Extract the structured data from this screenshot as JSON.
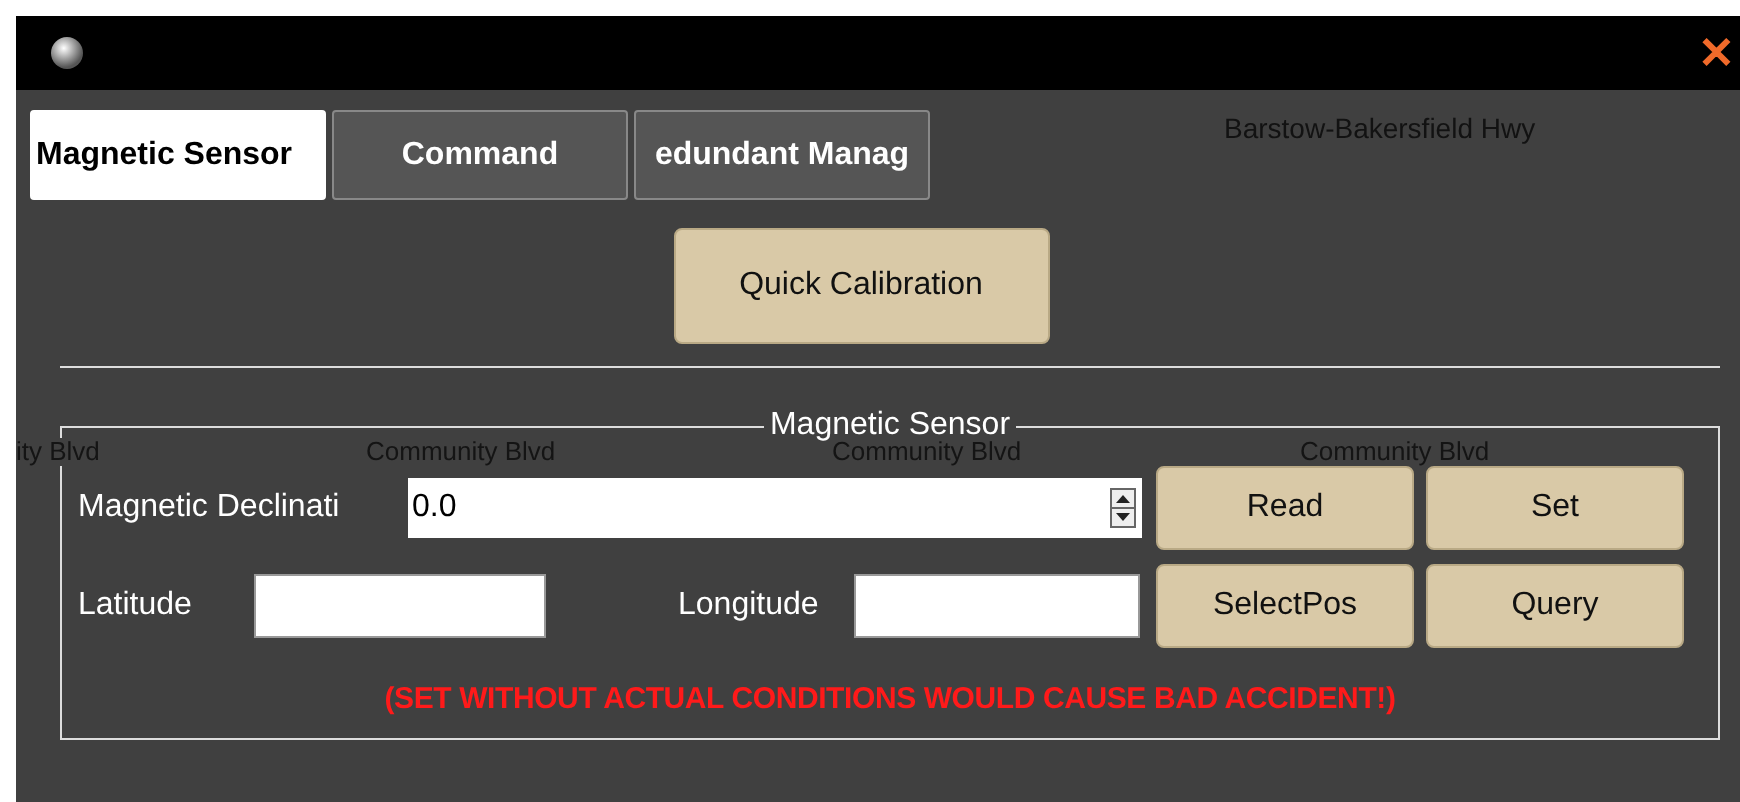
{
  "window": {
    "close": "✕"
  },
  "map_labels": [
    {
      "text": "Barstow-Bakersfield Hwy"
    },
    {
      "text": "ity Blvd"
    },
    {
      "text": "Community Blvd"
    },
    {
      "text": "Community Blvd"
    },
    {
      "text": "Community Blvd"
    }
  ],
  "tabs": [
    {
      "label": "Magnetic Sensor",
      "selected": true
    },
    {
      "label": "Command",
      "selected": false
    },
    {
      "label": "edundant Manag",
      "selected": false
    }
  ],
  "quick_calibration": {
    "label": "Quick Calibration"
  },
  "group": {
    "title": "Magnetic Sensor",
    "declination": {
      "label": "Magnetic Declinati",
      "value": "0.0"
    },
    "latitude": {
      "label": "Latitude"
    },
    "longitude": {
      "label": "Longitude"
    },
    "buttons": [
      {
        "label": "Read"
      },
      {
        "label": "Set"
      },
      {
        "label": "SelectPos"
      },
      {
        "label": "Query"
      }
    ],
    "warning": "(SET WITHOUT ACTUAL CONDITIONS WOULD CAUSE BAD ACCIDENT!)"
  }
}
